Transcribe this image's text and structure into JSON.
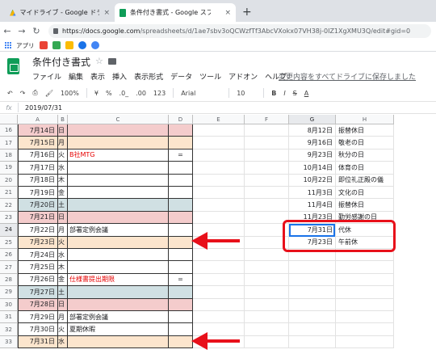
{
  "browser": {
    "tab1_title": "マイドライブ - Google ドライブ",
    "tab2_title": "条件付き書式 - Google スプレッドシ",
    "close": "×",
    "new_tab": "+",
    "url_host": "https://docs.google.com",
    "url_path": "/spreadsheets/d/1ae7sbv3oQCWzfTf3AbcVXokx07VH38j-0IZ1XgXMU3Q/edit#gid=0",
    "bookmarks_label": "アプリ"
  },
  "doc": {
    "title": "条件付き書式",
    "menu": [
      "ファイル",
      "編集",
      "表示",
      "挿入",
      "表示形式",
      "データ",
      "ツール",
      "アドオン",
      "ヘルプ"
    ],
    "save_link": "変更内容をすべてドライブに保存しました"
  },
  "toolbar": {
    "zoom": "100%",
    "currency": "¥",
    "percent": "%",
    "dec_dec": ".0_",
    "dec_inc": ".00",
    "format": "123",
    "font": "Arial",
    "size": "10",
    "bold": "B",
    "italic": "I",
    "strike": "S",
    "color": "A"
  },
  "formula": {
    "fx": "fx",
    "value": "2019/07/31"
  },
  "columns": [
    "A",
    "B",
    "C",
    "D",
    "E",
    "F",
    "G",
    "H"
  ],
  "rows": [
    {
      "n": "16",
      "a": "7月14日",
      "b": "日",
      "c": "",
      "d": "",
      "fill": "pink",
      "g": "8月12日",
      "h": "振替休日"
    },
    {
      "n": "17",
      "a": "7月15日",
      "b": "月",
      "c": "",
      "d": "",
      "fill": "peach",
      "g": "9月16日",
      "h": "敬老の日"
    },
    {
      "n": "18",
      "a": "7月16日",
      "b": "火",
      "c": "B社MTG",
      "d": "=",
      "fill": "",
      "g": "9月23日",
      "h": "秋分の日"
    },
    {
      "n": "19",
      "a": "7月17日",
      "b": "水",
      "c": "",
      "d": "",
      "fill": "",
      "g": "10月14日",
      "h": "体育の日"
    },
    {
      "n": "20",
      "a": "7月18日",
      "b": "木",
      "c": "",
      "d": "",
      "fill": "",
      "g": "10月22日",
      "h": "即位礼正殿の儀"
    },
    {
      "n": "21",
      "a": "7月19日",
      "b": "金",
      "c": "",
      "d": "",
      "fill": "",
      "g": "11月3日",
      "h": "文化の日"
    },
    {
      "n": "22",
      "a": "7月20日",
      "b": "土",
      "c": "",
      "d": "",
      "fill": "blue",
      "g": "11月4日",
      "h": "振替休日"
    },
    {
      "n": "23",
      "a": "7月21日",
      "b": "日",
      "c": "",
      "d": "",
      "fill": "pink",
      "g": "11月23日",
      "h": "勤労感謝の日"
    },
    {
      "n": "24",
      "a": "7月22日",
      "b": "月",
      "c": "部署定例会議",
      "d": "",
      "fill": "",
      "g": "7月31日",
      "h": "代休"
    },
    {
      "n": "25",
      "a": "7月23日",
      "b": "火",
      "c": "",
      "d": "",
      "fill": "peach",
      "g": "7月23日",
      "h": "午前休"
    },
    {
      "n": "26",
      "a": "7月24日",
      "b": "水",
      "c": "",
      "d": "",
      "fill": "",
      "g": "",
      "h": ""
    },
    {
      "n": "27",
      "a": "7月25日",
      "b": "木",
      "c": "",
      "d": "",
      "fill": "",
      "g": "",
      "h": ""
    },
    {
      "n": "28",
      "a": "7月26日",
      "b": "金",
      "c": "仕様書提出期限",
      "d": "=",
      "fill": "",
      "g": "",
      "h": ""
    },
    {
      "n": "29",
      "a": "7月27日",
      "b": "土",
      "c": "",
      "d": "",
      "fill": "blue",
      "g": "",
      "h": ""
    },
    {
      "n": "30",
      "a": "7月28日",
      "b": "日",
      "c": "",
      "d": "",
      "fill": "pink",
      "g": "",
      "h": ""
    },
    {
      "n": "31",
      "a": "7月29日",
      "b": "月",
      "c": "部署定例会議",
      "d": "",
      "fill": "",
      "g": "",
      "h": ""
    },
    {
      "n": "32",
      "a": "7月30日",
      "b": "火",
      "c": "夏期休暇",
      "d": "",
      "fill": "",
      "g": "",
      "h": ""
    },
    {
      "n": "33",
      "a": "7月31日",
      "b": "水",
      "c": "",
      "d": "",
      "fill": "peach",
      "g": "",
      "h": ""
    }
  ],
  "red_text_rows": [
    "18",
    "28"
  ],
  "selected_cell": "G24",
  "colors": {
    "accent_red": "#e8101a",
    "sheets_green": "#0f9d58",
    "selection_blue": "#1a73e8",
    "weekend_pink": "#f4cccc",
    "holiday_peach": "#fce5cd",
    "saturday_blue": "#d0e0e3"
  }
}
